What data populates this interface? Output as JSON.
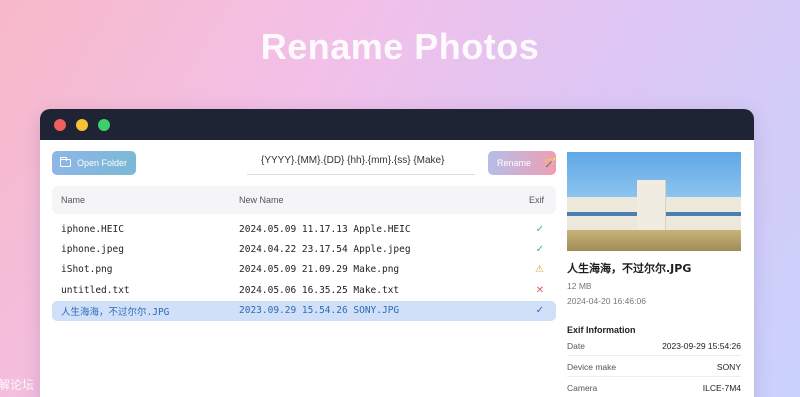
{
  "hero": {
    "title": "Rename Photos"
  },
  "watermark": "解论坛",
  "toolbar": {
    "open_label": "Open Folder",
    "pattern_value": "{YYYY}.{MM}.{DD} {hh}.{mm}.{ss} {Make}",
    "rename_label": "Rename",
    "rename_icon": "🪄"
  },
  "table": {
    "headers": {
      "name": "Name",
      "new_name": "New Name",
      "exif": "Exif"
    },
    "rows": [
      {
        "name": "iphone.HEIC",
        "new_name": "2024.05.09 11.17.13 Apple.HEIC",
        "exif": "✓",
        "status": "ok"
      },
      {
        "name": "iphone.jpeg",
        "new_name": "2024.04.22 23.17.54 Apple.jpeg",
        "exif": "✓",
        "status": "ok"
      },
      {
        "name": "iShot.png",
        "new_name": "2024.05.09 21.09.29 Make.png",
        "exif": "⚠",
        "status": "warn"
      },
      {
        "name": "untitled.txt",
        "new_name": "2024.05.06 16.35.25 Make.txt",
        "exif": "✕",
        "status": "error"
      },
      {
        "name": "人生海海，不过尔尔.JPG",
        "new_name": "2023.09.29 15.54.26 SONY.JPG",
        "exif": "✓",
        "status": "ok",
        "selected": true
      }
    ]
  },
  "details": {
    "filename": "人生海海，不过尔尔.JPG",
    "size": "12 MB",
    "date": "2024-04-20 16:46:06",
    "exif_title": "Exif Information",
    "exif": [
      {
        "label": "Date",
        "value": "2023-09-29 15:54:26"
      },
      {
        "label": "Device make",
        "value": "SONY"
      },
      {
        "label": "Camera",
        "value": "ILCE-7M4"
      }
    ]
  },
  "colors": {
    "titlebar": "#1e2433",
    "selected_row": "#cfe0f8",
    "ok": "#3fb685",
    "warn": "#e6a23c",
    "error": "#e15a6a"
  }
}
